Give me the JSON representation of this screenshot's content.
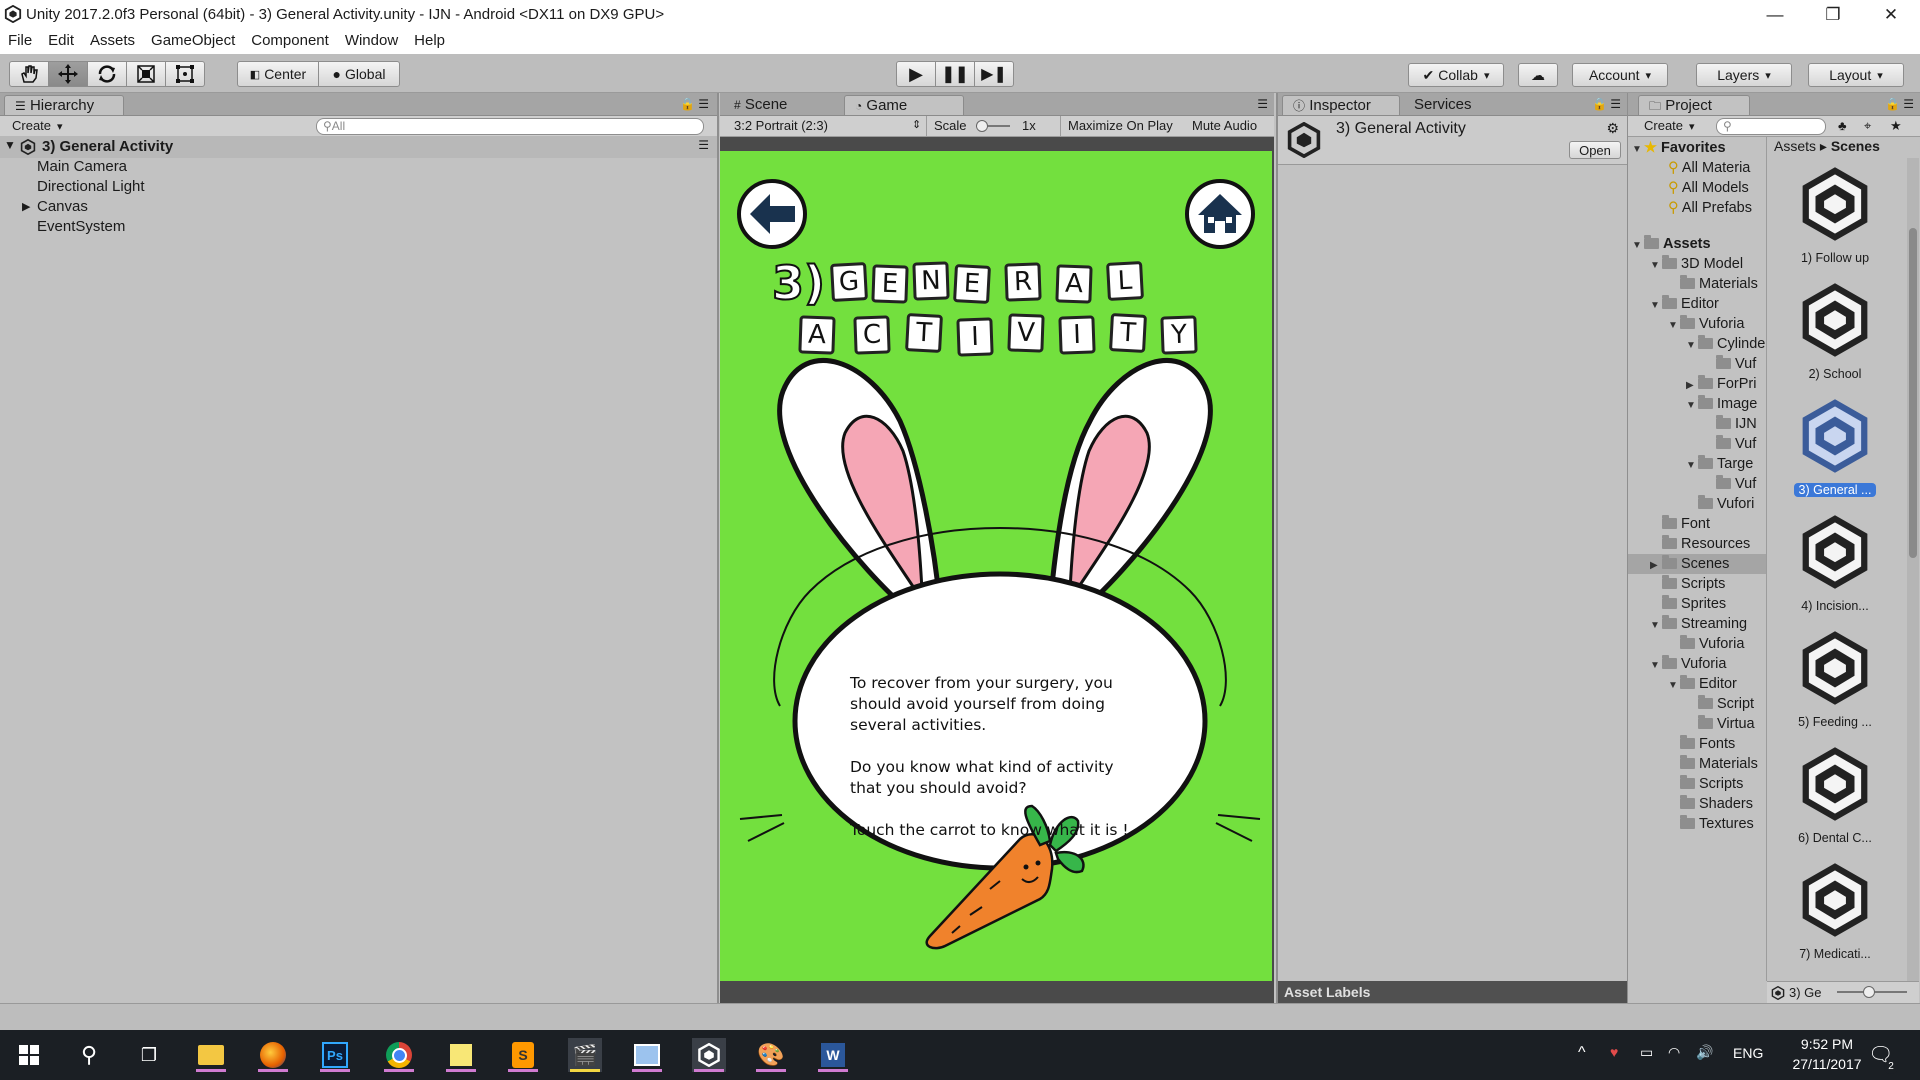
{
  "window": {
    "title": "Unity 2017.2.0f3 Personal (64bit) - 3) General Activity.unity - IJN - Android <DX11 on DX9 GPU>",
    "controls": [
      "—",
      "❐",
      "✕"
    ]
  },
  "menu": [
    "File",
    "Edit",
    "Assets",
    "GameObject",
    "Component",
    "Window",
    "Help"
  ],
  "toolbar": {
    "pivot_label": "Center",
    "space_label": "Global",
    "collab_label": "Collab",
    "account_label": "Account",
    "layers_label": "Layers",
    "layout_label": "Layout"
  },
  "hierarchy": {
    "tab_label": "Hierarchy",
    "create_label": "Create",
    "search_placeholder": "All",
    "scene_name": "3) General Activity",
    "items": [
      "Main Camera",
      "Directional Light",
      "Canvas",
      "EventSystem"
    ]
  },
  "game_view": {
    "scene_tab": "Scene",
    "game_tab": "Game",
    "aspect_label": "3:2 Portrait (2:3)",
    "scale_label": "Scale",
    "scale_value": "1x",
    "maximize_label": "Maximize On Play",
    "mute_label": "Mute Audio",
    "heading_prefix": "3)",
    "heading_word1": [
      "G",
      "E",
      "N",
      "E",
      "R",
      "A",
      "L"
    ],
    "heading_word2": [
      "A",
      "C",
      "T",
      "I",
      "V",
      "I",
      "T",
      "Y"
    ],
    "message_line1": "To recover from your surgery, you",
    "message_line2": "should avoid yourself from doing",
    "message_line3": "several activities.",
    "question_line1": "Do you know what kind of activity",
    "question_line2": "that you should avoid?",
    "prompt": "Touch the carrot to know what it is !",
    "colors": {
      "background": "#73e03e",
      "ear_inner": "#f5a6b5",
      "carrot": "#f0822c",
      "leaf": "#37b64a"
    }
  },
  "inspector": {
    "tab_label": "Inspector",
    "services_tab": "Services",
    "object_name": "3) General Activity",
    "open_label": "Open",
    "asset_labels": "Asset Labels"
  },
  "project": {
    "tab_label": "Project",
    "create_label": "Create",
    "breadcrumb_root": "Assets",
    "breadcrumb_sep": "▸",
    "breadcrumb_current": "Scenes",
    "favorites_label": "Favorites",
    "favorites": [
      "All Materia",
      "All Models",
      "All Prefabs"
    ],
    "tree": [
      {
        "label": "Assets",
        "depth": 0,
        "arrow": "▼",
        "bold": true
      },
      {
        "label": "3D Model",
        "depth": 1,
        "arrow": "▼"
      },
      {
        "label": "Materials",
        "depth": 2,
        "arrow": ""
      },
      {
        "label": "Editor",
        "depth": 1,
        "arrow": "▼"
      },
      {
        "label": "Vuforia",
        "depth": 2,
        "arrow": "▼"
      },
      {
        "label": "Cylinde",
        "depth": 3,
        "arrow": "▼"
      },
      {
        "label": "Vuf",
        "depth": 4,
        "arrow": ""
      },
      {
        "label": "ForPri",
        "depth": 3,
        "arrow": "▶"
      },
      {
        "label": "Image",
        "depth": 3,
        "arrow": "▼"
      },
      {
        "label": "IJN",
        "depth": 4,
        "arrow": ""
      },
      {
        "label": "Vuf",
        "depth": 4,
        "arrow": ""
      },
      {
        "label": "Targe",
        "depth": 3,
        "arrow": "▼"
      },
      {
        "label": "Vuf",
        "depth": 4,
        "arrow": ""
      },
      {
        "label": "Vufori",
        "depth": 3,
        "arrow": ""
      },
      {
        "label": "Font",
        "depth": 1,
        "arrow": ""
      },
      {
        "label": "Resources",
        "depth": 1,
        "arrow": ""
      },
      {
        "label": "Scenes",
        "depth": 1,
        "arrow": "▶",
        "selected": true
      },
      {
        "label": "Scripts",
        "depth": 1,
        "arrow": ""
      },
      {
        "label": "Sprites",
        "depth": 1,
        "arrow": ""
      },
      {
        "label": "Streaming",
        "depth": 1,
        "arrow": "▼"
      },
      {
        "label": "Vuforia",
        "depth": 2,
        "arrow": ""
      },
      {
        "label": "Vuforia",
        "depth": 1,
        "arrow": "▼"
      },
      {
        "label": "Editor",
        "depth": 2,
        "arrow": "▼"
      },
      {
        "label": "Script",
        "depth": 3,
        "arrow": ""
      },
      {
        "label": "Virtua",
        "depth": 3,
        "arrow": ""
      },
      {
        "label": "Fonts",
        "depth": 2,
        "arrow": ""
      },
      {
        "label": "Materials",
        "depth": 2,
        "arrow": ""
      },
      {
        "label": "Scripts",
        "depth": 2,
        "arrow": ""
      },
      {
        "label": "Shaders",
        "depth": 2,
        "arrow": ""
      },
      {
        "label": "Textures",
        "depth": 2,
        "arrow": ""
      }
    ],
    "scenes": [
      {
        "label": "1) Follow up"
      },
      {
        "label": "2) School"
      },
      {
        "label": "3) General ...",
        "selected": true
      },
      {
        "label": "4) Incision..."
      },
      {
        "label": "5) Feeding ..."
      },
      {
        "label": "6) Dental C..."
      },
      {
        "label": "7) Medicati..."
      }
    ],
    "footer_label": "3) Ge"
  },
  "taskbar": {
    "apps": [
      "start-icon",
      "search-icon",
      "task-view-icon",
      "file-explorer-icon",
      "firefox-icon",
      "photoshop-icon",
      "chrome-icon",
      "sticky-notes-icon",
      "sublime-icon",
      "clapper-icon",
      "photos-icon",
      "unity-icon",
      "paint-icon",
      "word-icon"
    ],
    "language": "ENG",
    "time": "9:52 PM",
    "date": "27/11/2017",
    "notification_count": "2"
  }
}
